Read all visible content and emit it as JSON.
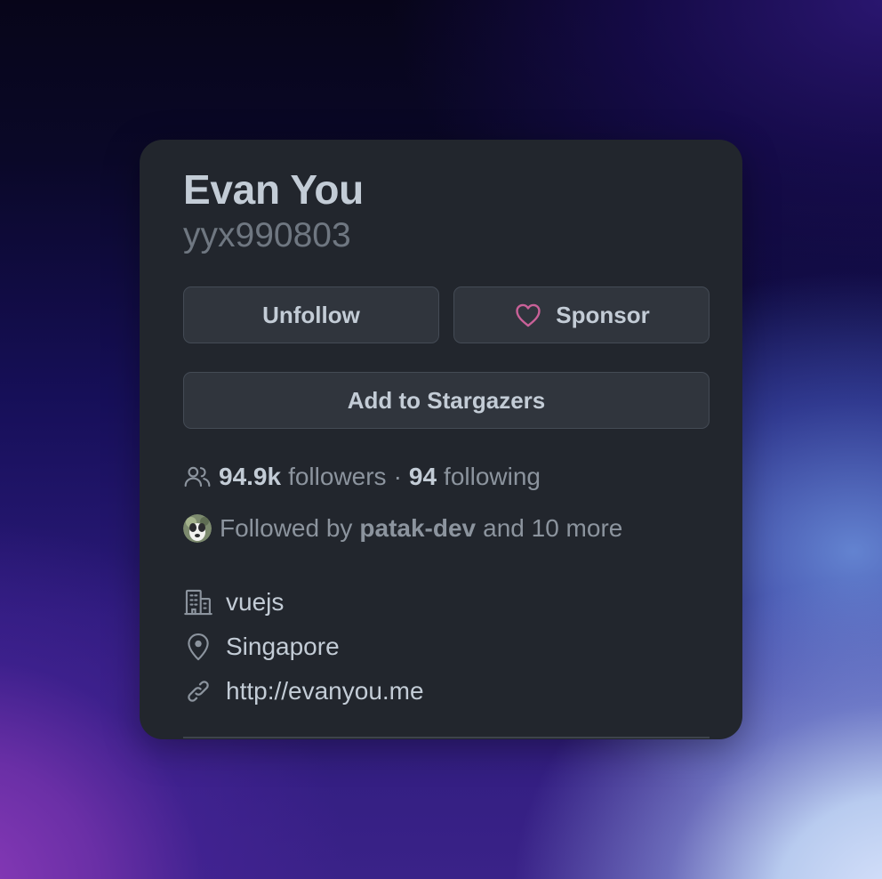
{
  "profile": {
    "name": "Evan You",
    "login": "yyx990803"
  },
  "actions": {
    "unfollow_label": "Unfollow",
    "sponsor_label": "Sponsor",
    "stargazers_label": "Add to Stargazers"
  },
  "stats": {
    "followers_count": "94.9k",
    "followers_label": "followers",
    "separator": "·",
    "following_count": "94",
    "following_label": "following"
  },
  "followed_by": {
    "prefix": "Followed by",
    "user": "patak-dev",
    "suffix": "and 10 more"
  },
  "details": {
    "organization": "vuejs",
    "location": "Singapore",
    "website": "http://evanyou.me"
  },
  "icons": {
    "people": "people-icon",
    "heart": "heart-icon",
    "organization": "organization-icon",
    "location": "location-pin-icon",
    "link": "link-icon"
  },
  "colors": {
    "card_bg": "#22262d",
    "text_primary": "#c3ccd6",
    "text_muted": "#8c949e",
    "button_bg": "#30353d",
    "button_border": "#444b55",
    "sponsor_heart": "#c96198"
  }
}
